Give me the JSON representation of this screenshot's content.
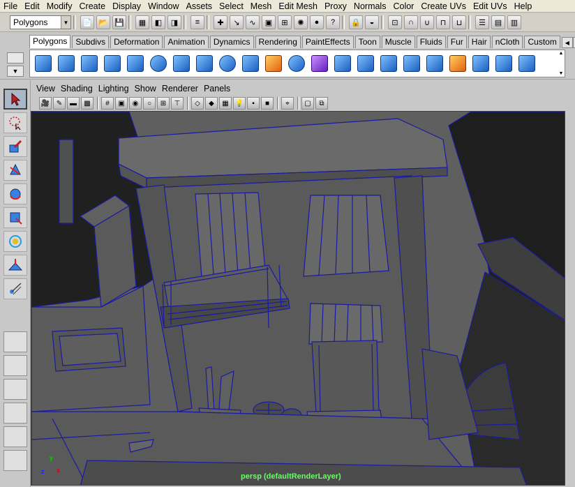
{
  "menubar": {
    "items": [
      "File",
      "Edit",
      "Modify",
      "Create",
      "Display",
      "Window",
      "Assets",
      "Select",
      "Mesh",
      "Edit Mesh",
      "Proxy",
      "Normals",
      "Color",
      "Create UVs",
      "Edit UVs",
      "Help"
    ]
  },
  "statusline": {
    "mode": "Polygons"
  },
  "shelf": {
    "tabs": [
      "Polygons",
      "Subdivs",
      "Deformation",
      "Animation",
      "Dynamics",
      "Rendering",
      "PaintEffects",
      "Toon",
      "Muscle",
      "Fluids",
      "Fur",
      "Hair",
      "nCloth",
      "Custom"
    ],
    "active_tab": "Polygons",
    "icons": [
      "poly-sphere-icon",
      "poly-cube-icon",
      "poly-cylinder-icon",
      "poly-cone-icon",
      "poly-plane-icon",
      "poly-torus-icon",
      "poly-pyramid-icon",
      "poly-pipe-icon",
      "combine-icon",
      "separate-icon",
      "extract-icon",
      "smooth-icon",
      "boolean-icon",
      "mirror-icon",
      "average-vertices-icon",
      "append-polygon-icon",
      "extrude-icon",
      "bridge-icon",
      "bevel-icon",
      "split-icon",
      "insert-loop-icon",
      "offset-loop-icon"
    ]
  },
  "panel": {
    "menu": [
      "View",
      "Shading",
      "Lighting",
      "Show",
      "Renderer",
      "Panels"
    ]
  },
  "viewport": {
    "camera_label": "persp (defaultRenderLayer)",
    "axis_x": "x",
    "axis_y": "y",
    "axis_z": "z"
  },
  "colors": {
    "viewport_bg": "#5f5f5f",
    "wireframe": "#1a1aa0",
    "menu_bg": "#ece9d8"
  }
}
